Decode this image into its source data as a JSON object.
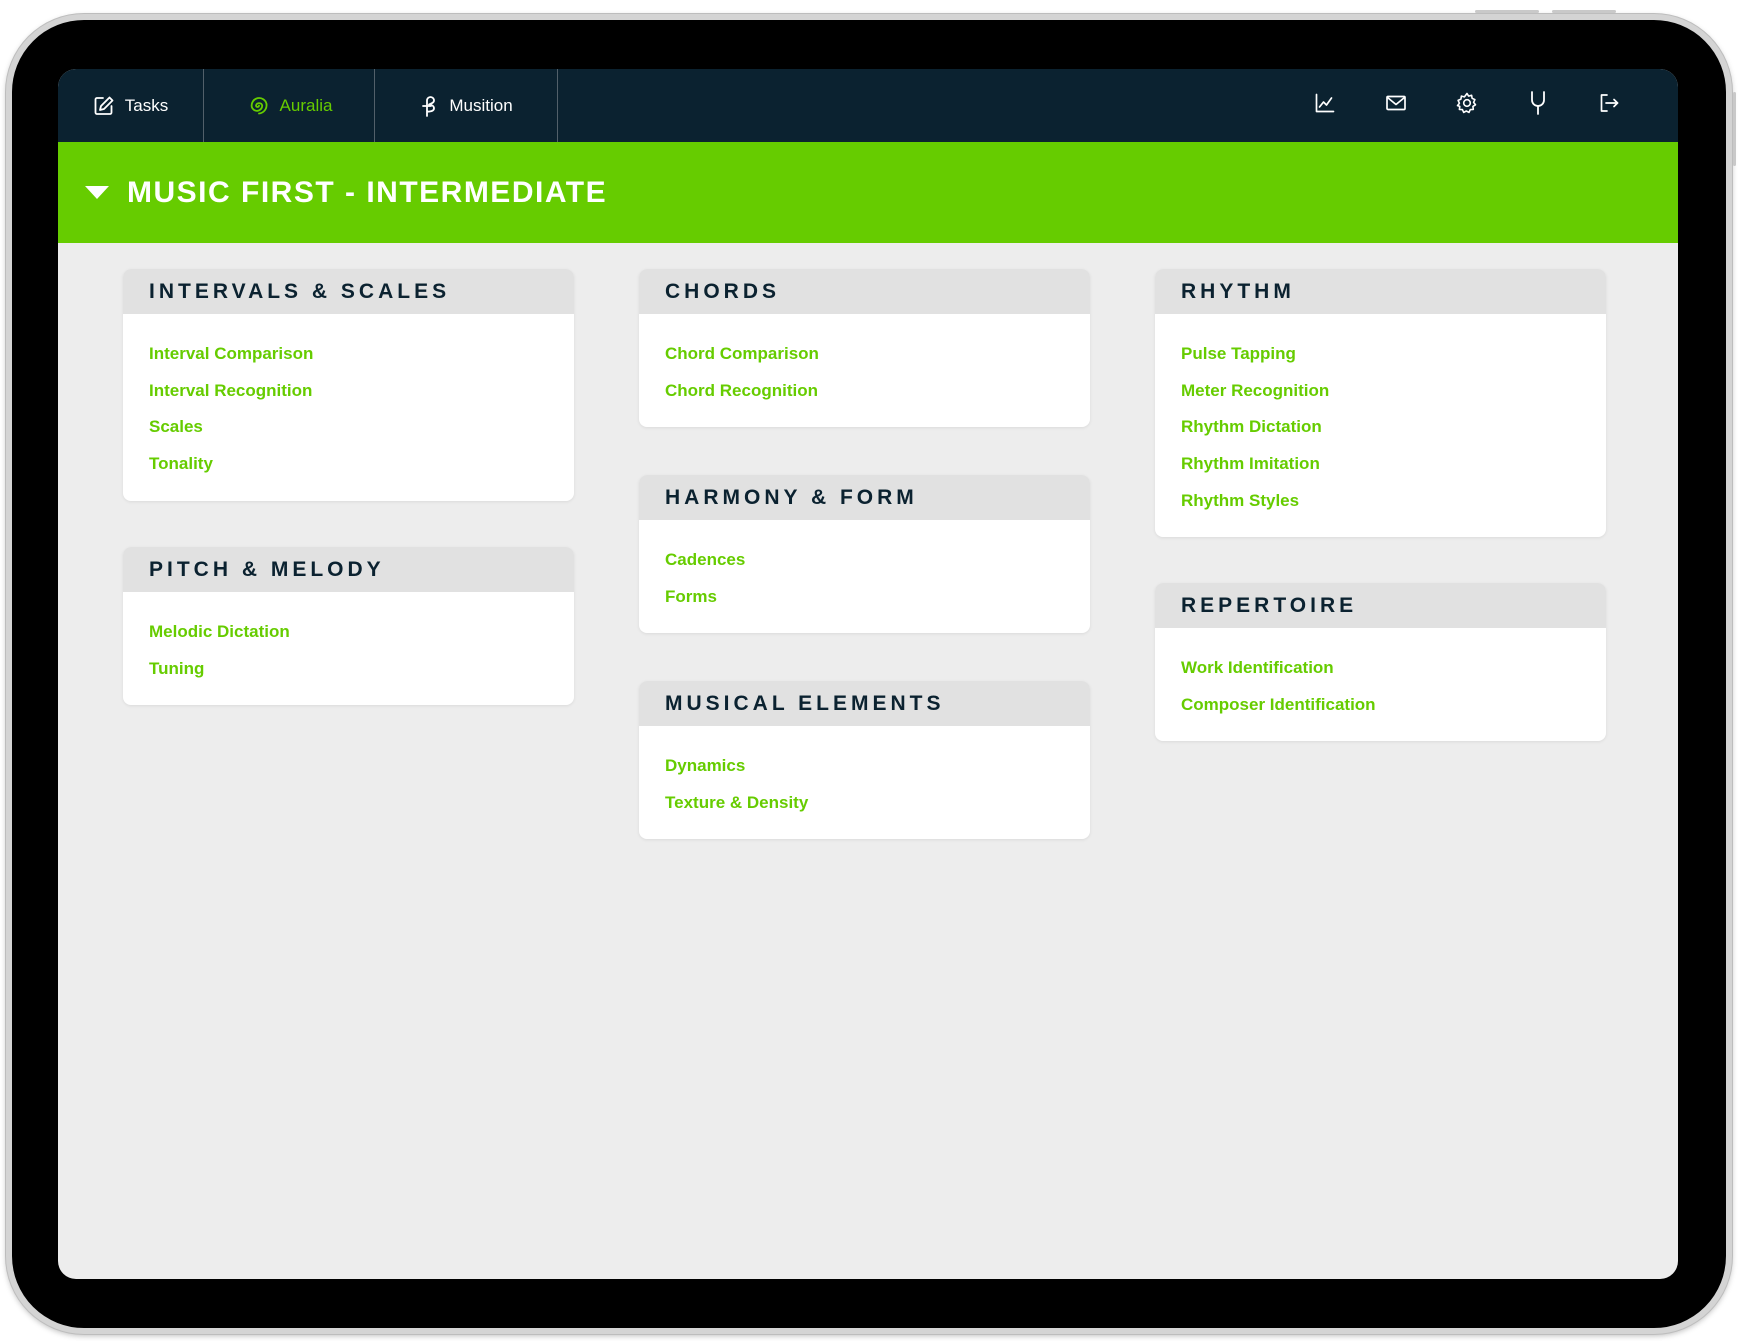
{
  "nav": {
    "tabs": [
      {
        "label": "Tasks",
        "icon": "edit-icon"
      },
      {
        "label": "Auralia",
        "icon": "auralia-logo-icon",
        "active": true
      },
      {
        "label": "Musition",
        "icon": "musition-logo-icon"
      }
    ],
    "tools": [
      "chart-icon",
      "mail-icon",
      "gear-icon",
      "tuning-fork-icon",
      "logout-icon"
    ]
  },
  "course": {
    "title": "MUSIC FIRST - INTERMEDIATE"
  },
  "colors": {
    "accent": "#66cc00",
    "navbar": "#0b2230",
    "background": "#ededed"
  },
  "sections": [
    {
      "title": "INTERVALS & SCALES",
      "items": [
        "Interval Comparison",
        "Interval Recognition",
        "Scales",
        "Tonality"
      ]
    },
    {
      "title": "PITCH & MELODY",
      "items": [
        "Melodic Dictation",
        "Tuning"
      ]
    },
    {
      "title": "CHORDS",
      "items": [
        "Chord Comparison",
        "Chord Recognition"
      ]
    },
    {
      "title": "HARMONY & FORM",
      "items": [
        "Cadences",
        "Forms"
      ]
    },
    {
      "title": "MUSICAL ELEMENTS",
      "items": [
        "Dynamics",
        "Texture & Density"
      ]
    },
    {
      "title": "RHYTHM",
      "items": [
        "Pulse Tapping",
        "Meter Recognition",
        "Rhythm Dictation",
        "Rhythm Imitation",
        "Rhythm Styles"
      ]
    },
    {
      "title": "REPERTOIRE",
      "items": [
        "Work Identification",
        "Composer Identification"
      ]
    }
  ]
}
